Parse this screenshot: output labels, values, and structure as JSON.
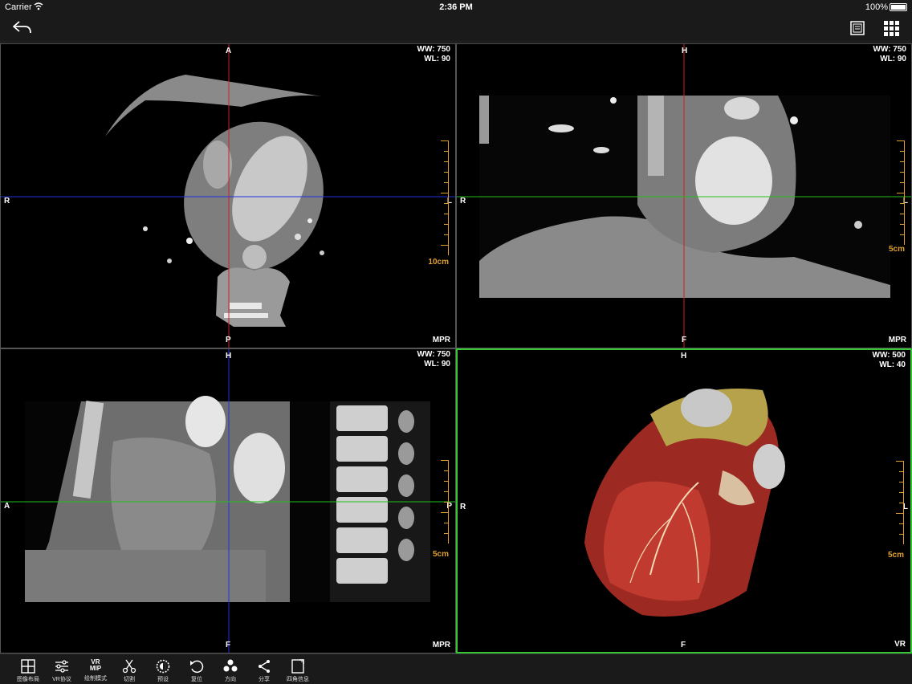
{
  "status_bar": {
    "carrier": "Carrier",
    "time": "2:36 PM",
    "battery": "100%"
  },
  "viewports": [
    {
      "id": "axial",
      "ww": "WW: 750",
      "wl": "WL: 90",
      "top": "A",
      "bottom": "P",
      "left": "R",
      "right": "L",
      "scale": "10cm",
      "mode": "MPR"
    },
    {
      "id": "coronal",
      "ww": "WW: 750",
      "wl": "WL: 90",
      "top": "H",
      "bottom": "F",
      "left": "R",
      "right": "L",
      "scale": "5cm",
      "mode": "MPR"
    },
    {
      "id": "sagittal",
      "ww": "WW: 750",
      "wl": "WL: 90",
      "top": "H",
      "bottom": "F",
      "left": "A",
      "right": "P",
      "scale": "5cm",
      "mode": "MPR"
    },
    {
      "id": "volume",
      "ww": "WW: 500",
      "wl": "WL: 40",
      "top": "H",
      "bottom": "F",
      "left": "R",
      "right": "L",
      "scale": "5cm",
      "mode": "VR"
    }
  ],
  "toolbar": [
    {
      "label": "图像布局",
      "icon": "layout-icon"
    },
    {
      "label": "VR协议",
      "icon": "sliders-icon"
    },
    {
      "label": "绘制模式",
      "icon": "vr-mip-icon",
      "icon_text_top": "VR",
      "icon_text_bottom": "MIP"
    },
    {
      "label": "切割",
      "icon": "scissors-icon"
    },
    {
      "label": "预设",
      "icon": "preset-icon"
    },
    {
      "label": "复位",
      "icon": "reset-icon"
    },
    {
      "label": "方向",
      "icon": "orientation-icon"
    },
    {
      "label": "分享",
      "icon": "share-icon"
    },
    {
      "label": "四角信息",
      "icon": "corner-info-icon"
    }
  ],
  "colors": {
    "active_border": "#34c634",
    "scale": "#e0a030",
    "crosshair_red": "#d02020",
    "crosshair_blue": "#2030e0",
    "crosshair_green": "#20c020"
  }
}
